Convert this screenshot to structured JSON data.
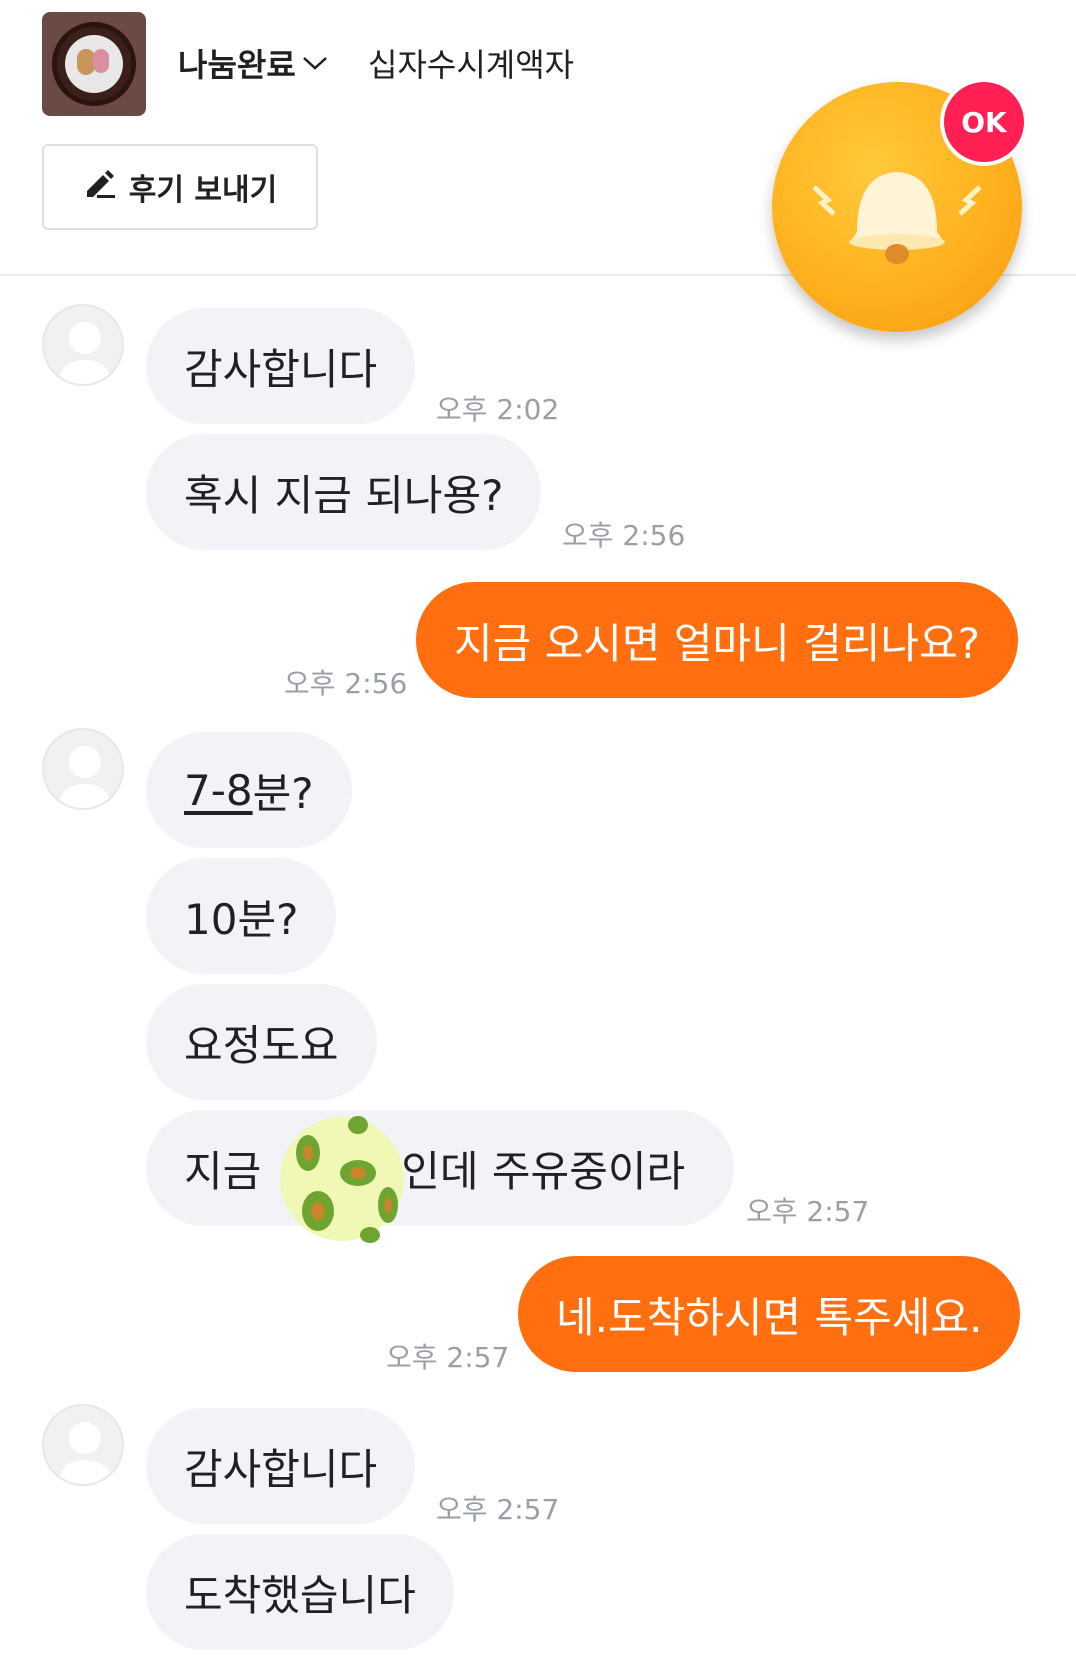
{
  "header": {
    "status_label": "나눔완료",
    "item_title": "십자수시계액자",
    "review_button_label": "후기 보내기",
    "ok_badge": "OK"
  },
  "messages": [
    {
      "text": "감사합니다",
      "time": "오후 2:02"
    },
    {
      "text": "혹시 지금 되나용?",
      "time": "오후 2:56"
    },
    {
      "text": "지금 오시면 얼마니 걸리나요?",
      "time": "오후 2:56"
    },
    {
      "text": "7-8",
      "suffix": "분?"
    },
    {
      "text": "10분?"
    },
    {
      "text": "요정도요"
    },
    {
      "prefix": "지금 ",
      "suffix": "인데 주유중이라",
      "time": "오후 2:57"
    },
    {
      "text": "네.도착하시면 톡주세요.",
      "time": "오후 2:57"
    },
    {
      "text": "감사합니다",
      "time": "오후 2:57"
    },
    {
      "text": "도착했습니다"
    }
  ],
  "colors": {
    "accent": "#ff6f0f",
    "incoming_bubble": "#f2f3f6",
    "badge": "#ff1f53"
  },
  "icons": [
    "pencil-icon",
    "chevron-down-icon",
    "bell-icon",
    "avatar-icon"
  ]
}
